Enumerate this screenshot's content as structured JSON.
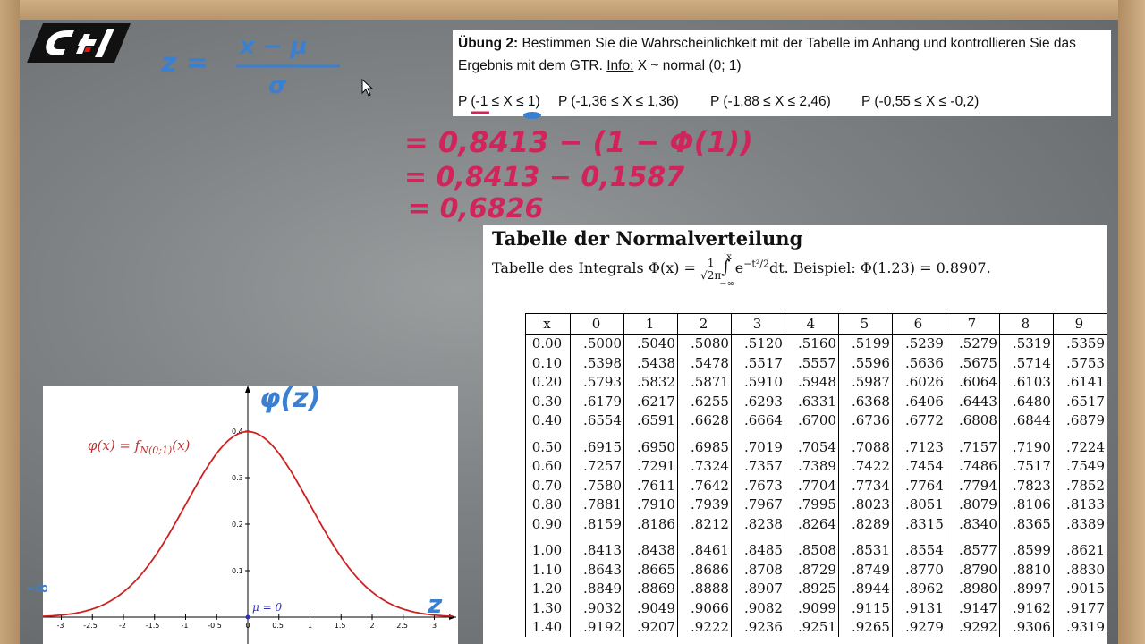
{
  "task": {
    "heading": "Übung 2:",
    "line1_rest": " Bestimmen Sie die Wahrscheinlichkeit mit der Tabelle im Anhang und kontrollieren Sie das",
    "line2_pre": "Ergebnis mit dem GTR. ",
    "info_label": "Info:",
    "info_text": " X ~ normal (0; 1)",
    "probs": [
      "P (-1 ≤ X ≤ 1)",
      "P (-1,36 ≤ X ≤ 1,36)",
      "P (-1,88 ≤ X ≤ 2,46)",
      "P (-0,55 ≤ X ≤ -0,2)"
    ]
  },
  "handwriting": {
    "formula_z": "z =",
    "formula_num": "x − μ",
    "formula_den": "σ",
    "step1": "= 0,8413 − (1 − Φ(1))",
    "step2": "= 0,8413 − 0,1587",
    "step3": "= 0,6826",
    "graph_label": "φ(z)",
    "minus_inf": "-∞",
    "axis_z": "z"
  },
  "table": {
    "title": "Tabelle der Normalverteilung",
    "subtitle_pre": "Tabelle des Integrals Φ(x) = ",
    "subtitle_post": " e",
    "subtitle_tail": "dt. Beispiel: Φ(1.23) = 0.8907.",
    "header": [
      "x",
      "0",
      "1",
      "2",
      "3",
      "4",
      "5",
      "6",
      "7",
      "8",
      "9"
    ],
    "rows": [
      [
        "0.00",
        ".5000",
        ".5040",
        ".5080",
        ".5120",
        ".5160",
        ".5199",
        ".5239",
        ".5279",
        ".5319",
        ".5359"
      ],
      [
        "0.10",
        ".5398",
        ".5438",
        ".5478",
        ".5517",
        ".5557",
        ".5596",
        ".5636",
        ".5675",
        ".5714",
        ".5753"
      ],
      [
        "0.20",
        ".5793",
        ".5832",
        ".5871",
        ".5910",
        ".5948",
        ".5987",
        ".6026",
        ".6064",
        ".6103",
        ".6141"
      ],
      [
        "0.30",
        ".6179",
        ".6217",
        ".6255",
        ".6293",
        ".6331",
        ".6368",
        ".6406",
        ".6443",
        ".6480",
        ".6517"
      ],
      [
        "0.40",
        ".6554",
        ".6591",
        ".6628",
        ".6664",
        ".6700",
        ".6736",
        ".6772",
        ".6808",
        ".6844",
        ".6879"
      ],
      [
        "0.50",
        ".6915",
        ".6950",
        ".6985",
        ".7019",
        ".7054",
        ".7088",
        ".7123",
        ".7157",
        ".7190",
        ".7224"
      ],
      [
        "0.60",
        ".7257",
        ".7291",
        ".7324",
        ".7357",
        ".7389",
        ".7422",
        ".7454",
        ".7486",
        ".7517",
        ".7549"
      ],
      [
        "0.70",
        ".7580",
        ".7611",
        ".7642",
        ".7673",
        ".7704",
        ".7734",
        ".7764",
        ".7794",
        ".7823",
        ".7852"
      ],
      [
        "0.80",
        ".7881",
        ".7910",
        ".7939",
        ".7967",
        ".7995",
        ".8023",
        ".8051",
        ".8079",
        ".8106",
        ".8133"
      ],
      [
        "0.90",
        ".8159",
        ".8186",
        ".8212",
        ".8238",
        ".8264",
        ".8289",
        ".8315",
        ".8340",
        ".8365",
        ".8389"
      ],
      [
        "1.00",
        ".8413",
        ".8438",
        ".8461",
        ".8485",
        ".8508",
        ".8531",
        ".8554",
        ".8577",
        ".8599",
        ".8621"
      ],
      [
        "1.10",
        ".8643",
        ".8665",
        ".8686",
        ".8708",
        ".8729",
        ".8749",
        ".8770",
        ".8790",
        ".8810",
        ".8830"
      ],
      [
        "1.20",
        ".8849",
        ".8869",
        ".8888",
        ".8907",
        ".8925",
        ".8944",
        ".8962",
        ".8980",
        ".8997",
        ".9015"
      ],
      [
        "1.30",
        ".9032",
        ".9049",
        ".9066",
        ".9082",
        ".9099",
        ".9115",
        ".9131",
        ".9147",
        ".9162",
        ".9177"
      ],
      [
        "1.40",
        ".9192",
        ".9207",
        ".9222",
        ".9236",
        ".9251",
        ".9265",
        ".9279",
        ".9292",
        ".9306",
        ".9319"
      ]
    ]
  },
  "graph": {
    "curve_label": "φ(x) = f",
    "curve_label_sub": "N(0;1)",
    "curve_label_arg": "(x)",
    "mu_label": "μ = 0",
    "x_ticks": [
      "-3",
      "-2.5",
      "-2",
      "-1.5",
      "-1",
      "-0.5",
      "0",
      "0.5",
      "1",
      "1.5",
      "2",
      "2.5",
      "3"
    ],
    "y_ticks": [
      "0.1",
      "0.2",
      "0.3",
      "0.4"
    ],
    "curve_color": "#cc2222"
  },
  "colors": {
    "blue_ink": "#3a7fd0",
    "red_ink": "#d0245a"
  }
}
